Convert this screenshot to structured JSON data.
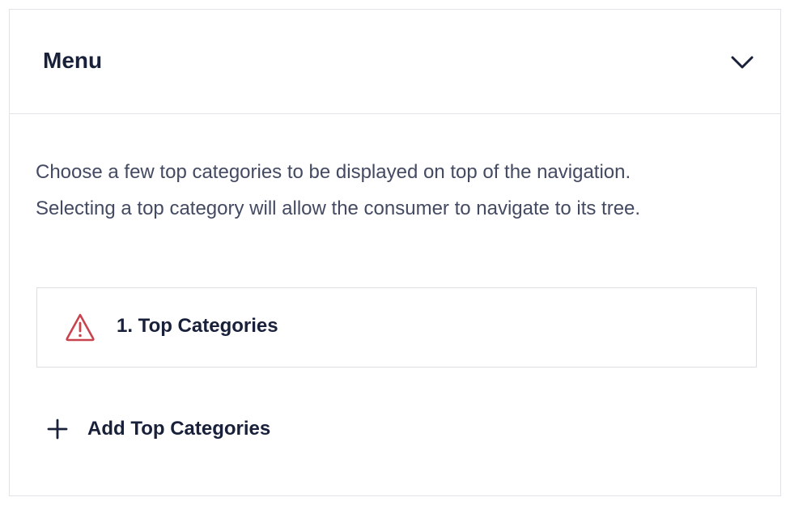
{
  "menu": {
    "title": "Menu",
    "expanded": true,
    "description_lines": [
      "Choose a few top categories to be displayed on top of the navigation.",
      "Selecting a top category will allow the consumer to navigate to its tree."
    ],
    "items": [
      {
        "label": "1. Top Categories",
        "status": "warning",
        "status_icon": "warning-triangle-icon",
        "status_color": "#c8434f"
      }
    ],
    "add_button": {
      "label": "Add Top Categories",
      "icon": "plus-icon"
    }
  },
  "colors": {
    "text_primary": "#18203a",
    "text_secondary": "#434a62",
    "border": "#e1e3e8",
    "warning": "#c8434f"
  }
}
